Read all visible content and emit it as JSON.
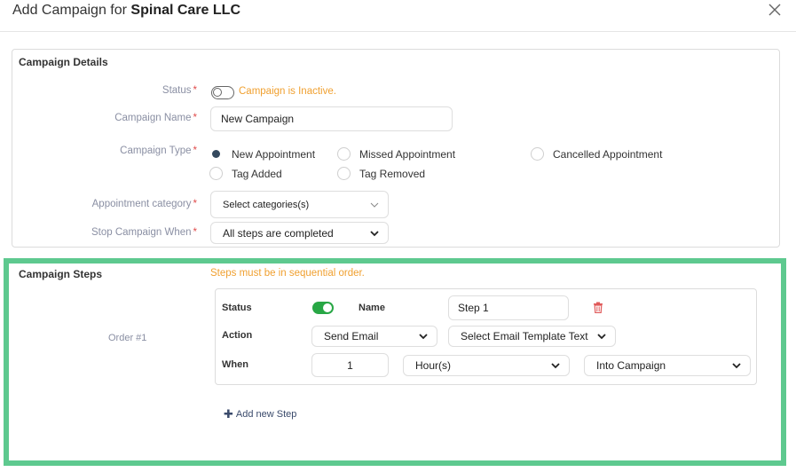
{
  "header": {
    "title_prefix": "Add Campaign for",
    "title_name": "Spinal Care LLC"
  },
  "details": {
    "title": "Campaign Details",
    "status_label": "Status",
    "status_text": "Campaign is Inactive.",
    "status_enabled": false,
    "name_label": "Campaign Name",
    "name_value": "New Campaign",
    "type_label": "Campaign Type",
    "type_options": [
      {
        "label": "New Appointment",
        "checked": true
      },
      {
        "label": "Missed Appointment",
        "checked": false
      },
      {
        "label": "Cancelled Appointment",
        "checked": false
      },
      {
        "label": "Tag Added",
        "checked": false
      },
      {
        "label": "Tag Removed",
        "checked": false
      }
    ],
    "category_label": "Appointment category",
    "category_placeholder": "Select categories(s)",
    "stop_label": "Stop Campaign When",
    "stop_value": "All steps are completed",
    "required_mark": "*"
  },
  "steps": {
    "title": "Campaign Steps",
    "note": "Steps must be in sequential order.",
    "items": [
      {
        "order_label": "Order #1",
        "status_label": "Status",
        "status_enabled": true,
        "name_label": "Name",
        "name_value": "Step 1",
        "action_label": "Action",
        "action_value": "Send Email",
        "template_value": "Select Email Template Text",
        "when_label": "When",
        "when_amount": "1",
        "when_unit": "Hour(s)",
        "when_reference": "Into Campaign"
      }
    ],
    "add_label": "Add new Step"
  },
  "colors": {
    "accent_warning": "#f0a030",
    "highlight_border": "#5ec98f",
    "toggle_on": "#28a745",
    "required": "#e04b4b",
    "trash": "#e05a5a"
  }
}
